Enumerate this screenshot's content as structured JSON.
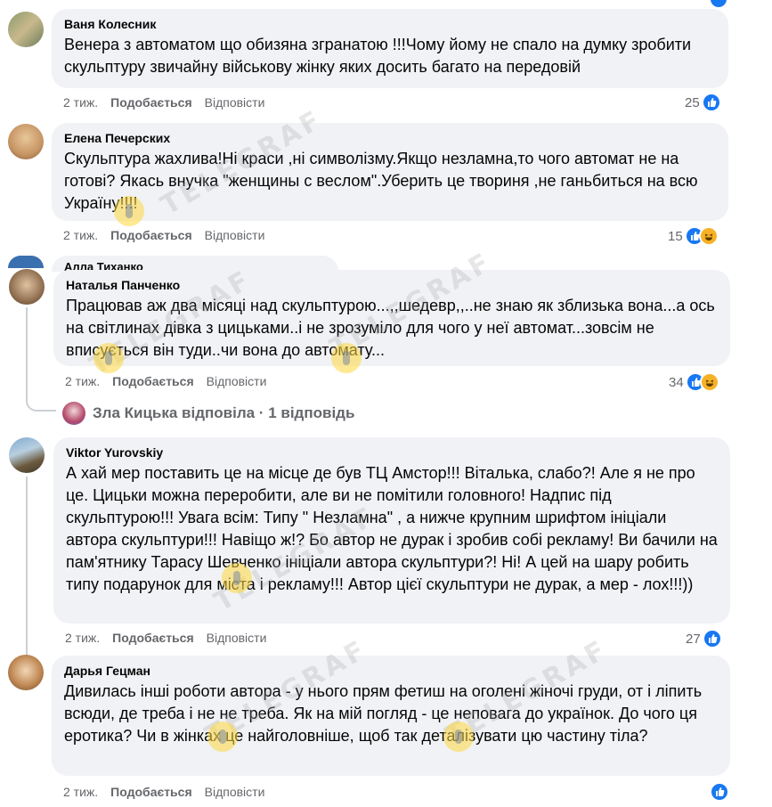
{
  "comments": [
    {
      "author": "Ваня Колесник",
      "text": "Венера з автоматом що обизяна згранатою !!!Чому йому не спало на думку зробити скульптуру звичайну військову жінку яких досить багато на передовій",
      "time": "2 тиж.",
      "like_label": "Подобається",
      "reply_label": "Відповісти",
      "reaction_count": "25"
    },
    {
      "author": "Елена Печерских",
      "text": "Скульптура жахлива!Ні краси ,ні символізму.Якщо незламна,то чого автомат не на готові? Якась внучка \"женщины с веслом\".Уберить це твориня ,не ганьбиться на всю Україну!!!!",
      "time": "2 тиж.",
      "like_label": "Подобається",
      "reply_label": "Відповісти",
      "reaction_count": "15"
    },
    {
      "author": "Алла Тиханко",
      "author_partial": "Алла Тиханко"
    },
    {
      "author": "Наталья Панченко",
      "text": "Працював аж два місяці над скульптурою...,,шедевр,,..не знаю як зблизька вона...а ось на світлинах дівка з цицьками..і не зрозуміло для чого у неї автомат...зовсім не вписується він туди..чи вона до автомату...",
      "time": "2 тиж.",
      "like_label": "Подобається",
      "reply_label": "Відповісти",
      "reaction_count": "34"
    },
    {
      "author": "Viktor Yurovskiy",
      "text": "А хай мер поставить це на місце де був ТЦ Амстор!!! Віталька, слабо?! Але я не про це. Цицьки можна переробити, але ви не помітили головного! Надпис під скульптурою!!! Увага всім: Типу \" Незламна\" , а нижче крупним шрифтом ініціали автора скульптури!!! Навіщо ж!? Бо автор не дурак і зробив собі рекламу! Ви бачили на пам'ятнику Тарасу Шевченко ініціали автора скульптури?! Ні! А цей на шару робить типу подарунок для міста і рекламу!!! Автор цієї скульптури не дурак, а мер - лох!!!))",
      "time": "2 тиж.",
      "like_label": "Подобається",
      "reply_label": "Відповісти",
      "reaction_count": "27"
    },
    {
      "author": "Дарья Гецман",
      "text": "Дивилась інші роботи автора - у нього прям фетиш на оголені жіночі груди, от і ліпить всюди, де треба і не не треба. Як на мій погляд - це неповага до українок. До чого ця еротика? Чи в жінках це найголовніше, щоб так деталізувати цю частину тіла?",
      "time": "2 тиж.",
      "like_label": "Подобається",
      "reply_label": "Відповісти",
      "reaction_count": ""
    }
  ],
  "replies_link": "Зла Кицька відповіла · 1 відповідь",
  "watermark": "TELEGRAF",
  "colors": {
    "bubble": "#f0f2f5",
    "like_blue": "#1877f2",
    "haha_yellow": "#f7b125",
    "meta_text": "#65676b"
  }
}
